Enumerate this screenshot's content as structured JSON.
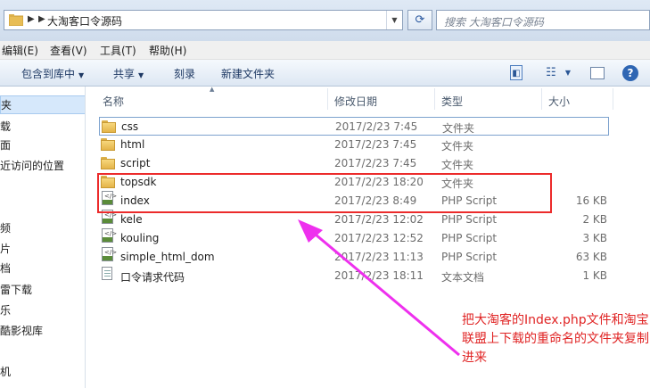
{
  "address": {
    "path": "大淘客口令源码",
    "search_placeholder": "搜索 大淘客口令源码"
  },
  "menu": [
    "编辑(E)",
    "查看(V)",
    "工具(T)",
    "帮助(H)"
  ],
  "toolbar": {
    "include_library": "包含到库中",
    "share": "共享",
    "burn": "刻录",
    "new_folder": "新建文件夹"
  },
  "navpane": {
    "items": [
      "夹",
      "载",
      "面",
      "近访问的位置",
      "频",
      "片",
      "档",
      "雷下载",
      "乐",
      "酷影视库",
      "机"
    ]
  },
  "columns": {
    "name": "名称",
    "date": "修改日期",
    "type": "类型",
    "size": "大小"
  },
  "files": [
    {
      "name": "css",
      "date": "2017/2/23 7:45",
      "type": "文件夹",
      "size": "",
      "icon": "folder-icon"
    },
    {
      "name": "html",
      "date": "2017/2/23 7:45",
      "type": "文件夹",
      "size": "",
      "icon": "folder-icon"
    },
    {
      "name": "script",
      "date": "2017/2/23 7:45",
      "type": "文件夹",
      "size": "",
      "icon": "folder-icon"
    },
    {
      "name": "topsdk",
      "date": "2017/2/23 18:20",
      "type": "文件夹",
      "size": "",
      "icon": "folder-icon"
    },
    {
      "name": "index",
      "date": "2017/2/23 8:49",
      "type": "PHP Script",
      "size": "16 KB",
      "icon": "php-file-icon"
    },
    {
      "name": "kele",
      "date": "2017/2/23 12:02",
      "type": "PHP Script",
      "size": "2 KB",
      "icon": "php-file-icon"
    },
    {
      "name": "kouling",
      "date": "2017/2/23 12:52",
      "type": "PHP Script",
      "size": "3 KB",
      "icon": "php-file-icon"
    },
    {
      "name": "simple_html_dom",
      "date": "2017/2/23 11:13",
      "type": "PHP Script",
      "size": "63 KB",
      "icon": "php-file-icon"
    },
    {
      "name": "口令请求代码",
      "date": "2017/2/23 18:11",
      "type": "文本文档",
      "size": "1 KB",
      "icon": "text-file-icon"
    }
  ],
  "annotation": {
    "text": "把大淘客的Index.php文件和淘宝联盟上下载的重命名的文件夹复制进来",
    "color": "#e02424",
    "arrow_color": "#ee30ee"
  }
}
